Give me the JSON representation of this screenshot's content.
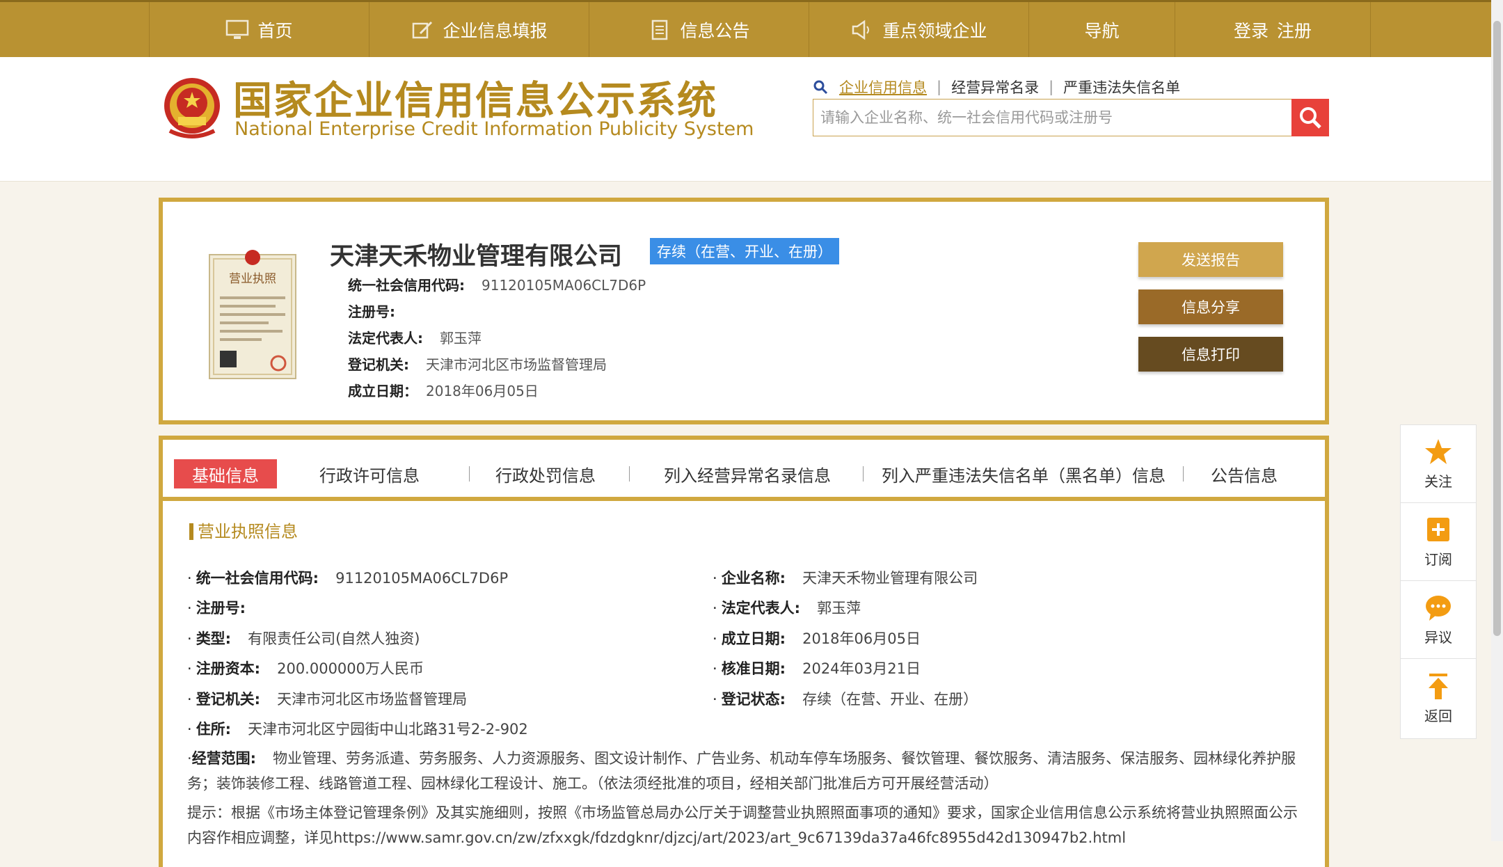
{
  "topnav": {
    "items": [
      {
        "label": "首页",
        "icon": "monitor-icon"
      },
      {
        "label": "企业信息填报",
        "icon": "edit-icon"
      },
      {
        "label": "信息公告",
        "icon": "document-icon"
      },
      {
        "label": "重点领域企业",
        "icon": "speaker-icon"
      },
      {
        "label": "导航"
      },
      {
        "login": "登录",
        "register": "注册"
      }
    ]
  },
  "header": {
    "logo_cn": "国家企业信用信息公示系统",
    "logo_en": "National Enterprise Credit Information Publicity System",
    "search_tabs": [
      "企业信用信息",
      "经营异常名录",
      "严重违法失信名单"
    ],
    "search_placeholder": "请输入企业名称、统一社会信用代码或注册号"
  },
  "company": {
    "name": "天津天禾物业管理有限公司",
    "status": "存续（在营、开业、在册）",
    "rows": [
      {
        "label": "统一社会信用代码:",
        "value": "91120105MA06CL7D6P"
      },
      {
        "label": "注册号:",
        "value": ""
      },
      {
        "label": "法定代表人:",
        "value": "郭玉萍"
      },
      {
        "label": "登记机关:",
        "value": "天津市河北区市场监督管理局"
      },
      {
        "label": "成立日期：",
        "value": "2018年06月05日"
      }
    ],
    "license_label": "营业执照",
    "buttons": [
      "发送报告",
      "信息分享",
      "信息打印"
    ]
  },
  "tabs": [
    "基础信息",
    "行政许可信息",
    "行政处罚信息",
    "列入经营异常名录信息",
    "列入严重违法失信名单（黑名单）信息",
    "公告信息"
  ],
  "basic": {
    "section_title": "营业执照信息",
    "left": [
      {
        "label": "统一社会信用代码:",
        "value": "91120105MA06CL7D6P"
      },
      {
        "label": "注册号:",
        "value": ""
      },
      {
        "label": "类型:",
        "value": "有限责任公司(自然人独资)"
      },
      {
        "label": "注册资本:",
        "value": "200.000000万人民币"
      },
      {
        "label": "登记机关:",
        "value": "天津市河北区市场监督管理局"
      },
      {
        "label": "住所:",
        "value": "天津市河北区宁园街中山北路31号2-2-902"
      }
    ],
    "right": [
      {
        "label": "企业名称:",
        "value": "天津天禾物业管理有限公司"
      },
      {
        "label": "法定代表人:",
        "value": "郭玉萍"
      },
      {
        "label": "成立日期:",
        "value": "2018年06月05日"
      },
      {
        "label": "核准日期:",
        "value": "2024年03月21日"
      },
      {
        "label": "登记状态:",
        "value": "存续（在营、开业、在册）"
      }
    ],
    "scope_label": "经营范围:",
    "scope": "物业管理、劳务派遣、劳务服务、人力资源服务、图文设计制作、广告业务、机动车停车场服务、餐饮管理、餐饮服务、清洁服务、保洁服务、园林绿化养护服务；装饰装修工程、线路管道工程、园林绿化工程设计、施工。（依法须经批准的项目，经相关部门批准后方可开展经营活动）",
    "hint": "提示：根据《市场主体登记管理条例》及其实施细则，按照《市场监管总局办公厅关于调整营业执照照面事项的通知》要求，国家企业信用信息公示系统将营业执照照面公示内容作相应调整，详见https://www.samr.gov.cn/zw/zfxxgk/fdzdgknr/djzcj/art/2023/art_9c67139da37a46fc8955d42d130947b2.html"
  },
  "floatbar": [
    "关注",
    "订阅",
    "异议",
    "返回"
  ],
  "colors": {
    "gold": "#b99232",
    "frame": "#d0a83f",
    "red": "#e74c4c",
    "blue": "#3a8ee6"
  }
}
